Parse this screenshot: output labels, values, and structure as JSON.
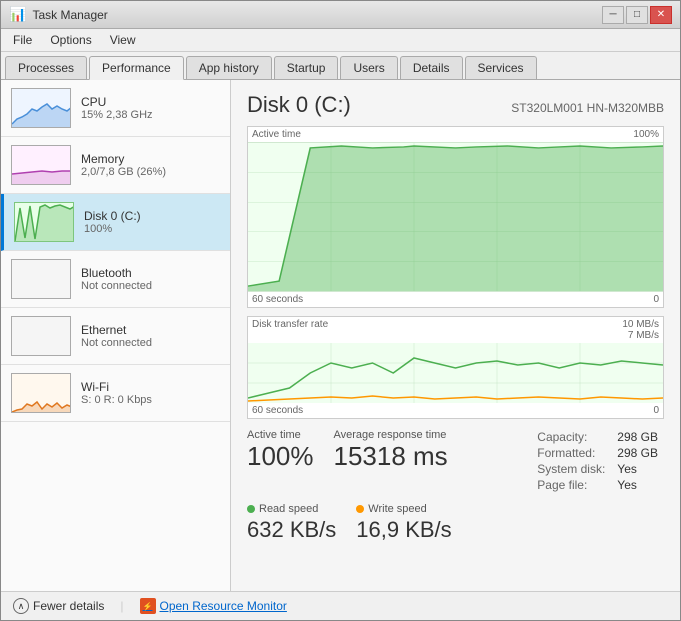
{
  "window": {
    "title": "Task Manager",
    "icon": "📊"
  },
  "menu": {
    "items": [
      "File",
      "Options",
      "View"
    ]
  },
  "tabs": [
    {
      "label": "Processes",
      "active": false
    },
    {
      "label": "Performance",
      "active": true
    },
    {
      "label": "App history",
      "active": false
    },
    {
      "label": "Startup",
      "active": false
    },
    {
      "label": "Users",
      "active": false
    },
    {
      "label": "Details",
      "active": false
    },
    {
      "label": "Services",
      "active": false
    }
  ],
  "sidebar": {
    "items": [
      {
        "name": "CPU",
        "sub": "15% 2,38 GHz",
        "type": "cpu"
      },
      {
        "name": "Memory",
        "sub": "2,0/7,8 GB (26%)",
        "type": "memory"
      },
      {
        "name": "Disk 0 (C:)",
        "sub": "100%",
        "type": "disk",
        "active": true
      },
      {
        "name": "Bluetooth",
        "sub": "Not connected",
        "type": "bluetooth"
      },
      {
        "name": "Ethernet",
        "sub": "Not connected",
        "type": "ethernet"
      },
      {
        "name": "Wi-Fi",
        "sub": "S: 0 R: 0 Kbps",
        "type": "wifi"
      }
    ]
  },
  "main": {
    "disk_title": "Disk 0 (C:)",
    "disk_model": "ST320LM001 HN-M320MBB",
    "chart1": {
      "top_left": "Active time",
      "top_right": "100%",
      "bottom_left": "60 seconds",
      "bottom_right": "0"
    },
    "chart2": {
      "top_right_1": "10 MB/s",
      "top_right_2": "7 MB/s",
      "label_left": "Disk transfer rate",
      "bottom_left": "60 seconds",
      "bottom_right": "0"
    },
    "stats": {
      "active_time_label": "Active time",
      "active_time_value": "100%",
      "avg_response_label": "Average response time",
      "avg_response_value": "15318 ms",
      "capacity_label": "Capacity:",
      "capacity_value": "298 GB",
      "formatted_label": "Formatted:",
      "formatted_value": "298 GB",
      "system_disk_label": "System disk:",
      "system_disk_value": "Yes",
      "page_file_label": "Page file:",
      "page_file_value": "Yes"
    },
    "speeds": {
      "read_label": "Read speed",
      "read_value": "632 KB/s",
      "write_label": "Write speed",
      "write_value": "16,9 KB/s"
    }
  },
  "footer": {
    "fewer_details": "Fewer details",
    "open_resource_monitor": "Open Resource Monitor"
  }
}
